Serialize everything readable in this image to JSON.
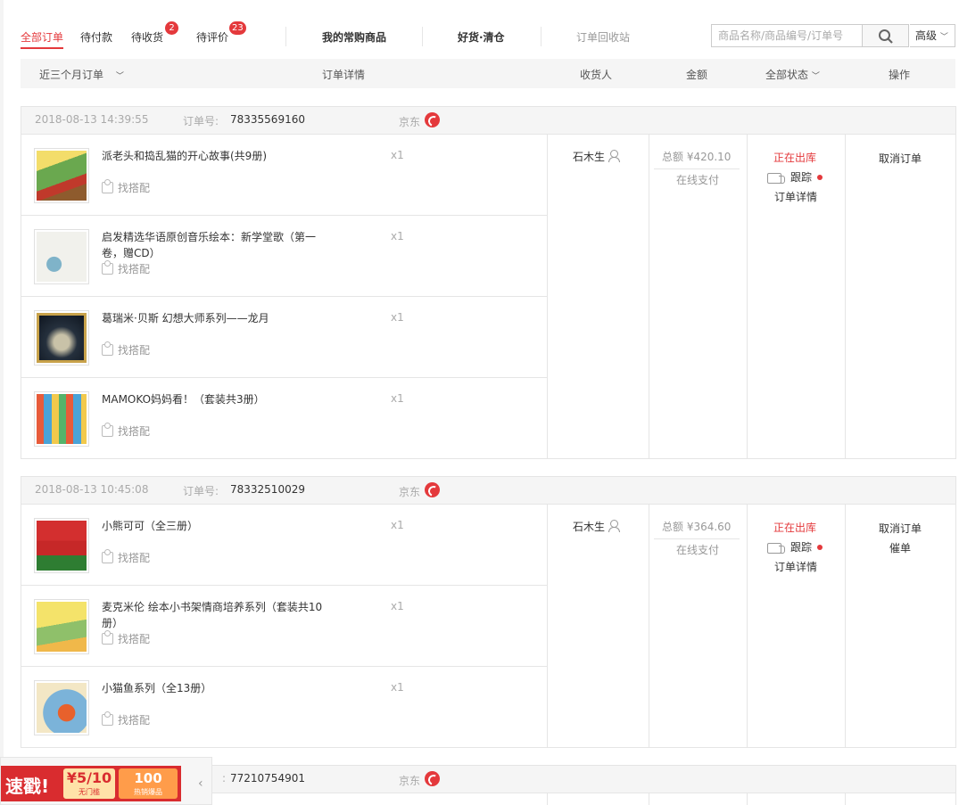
{
  "tabs": [
    {
      "label": "全部订单",
      "badge": ""
    },
    {
      "label": "待付款",
      "badge": ""
    },
    {
      "label": "待收货",
      "badge": "2"
    },
    {
      "label": "待评价",
      "badge": "23"
    }
  ],
  "links": {
    "frequent": "我的常购商品",
    "clearance": "好货·清仓",
    "recycle": "订单回收站"
  },
  "search": {
    "placeholder": "商品名称/商品编号/订单号",
    "advanced": "高级"
  },
  "table_header": {
    "period": "近三个月订单",
    "detail": "订单详情",
    "consignee": "收货人",
    "amount": "金额",
    "status": "全部状态",
    "action": "操作"
  },
  "orders": [
    {
      "date": "2018-08-13 14:39:55",
      "order_label": "订单号:",
      "order_no": "78335569160",
      "shop": "京东",
      "items": [
        {
          "name": "派老头和捣乱猫的开心故事(共9册)",
          "qty": "x1",
          "match": "找搭配"
        },
        {
          "name": "启发精选华语原创音乐绘本：新学堂歌（第一卷，赠CD）",
          "qty": "x1",
          "match": "找搭配"
        },
        {
          "name": "葛瑞米·贝斯 幻想大师系列——龙月",
          "qty": "x1",
          "match": "找搭配"
        },
        {
          "name": "MAMOKO妈妈看！（套装共3册）",
          "qty": "x1",
          "match": "找搭配"
        }
      ],
      "consignee": "石木生",
      "amount": "总额 ¥420.10",
      "payment": "在线支付",
      "status": "正在出库",
      "track": "跟踪",
      "detail": "订单详情",
      "actions": [
        "取消订单"
      ]
    },
    {
      "date": "2018-08-13 10:45:08",
      "order_label": "订单号:",
      "order_no": "78332510029",
      "shop": "京东",
      "items": [
        {
          "name": "小熊可可（全三册）",
          "qty": "x1",
          "match": "找搭配"
        },
        {
          "name": "麦克米伦 绘本小书架情商培养系列（套装共10册）",
          "qty": "x1",
          "match": "找搭配"
        },
        {
          "name": "小猫鱼系列（全13册）",
          "qty": "x1",
          "match": "找搭配"
        }
      ],
      "consignee": "石木生",
      "amount": "总额 ¥364.60",
      "payment": "在线支付",
      "status": "正在出库",
      "track": "跟踪",
      "detail": "订单详情",
      "actions": [
        "取消订单",
        "催单"
      ]
    },
    {
      "order_label": ":",
      "order_no": "77210754901",
      "shop": "京东"
    }
  ],
  "promo": {
    "title": "速戳!",
    "coupon1_big": "¥5/10",
    "coupon1_small": "无门槛",
    "coupon2_big": "100",
    "coupon2_small": "热销爆品"
  },
  "colors": {
    "accent": "#e4393c",
    "header_bg": "#f5f5f5"
  }
}
